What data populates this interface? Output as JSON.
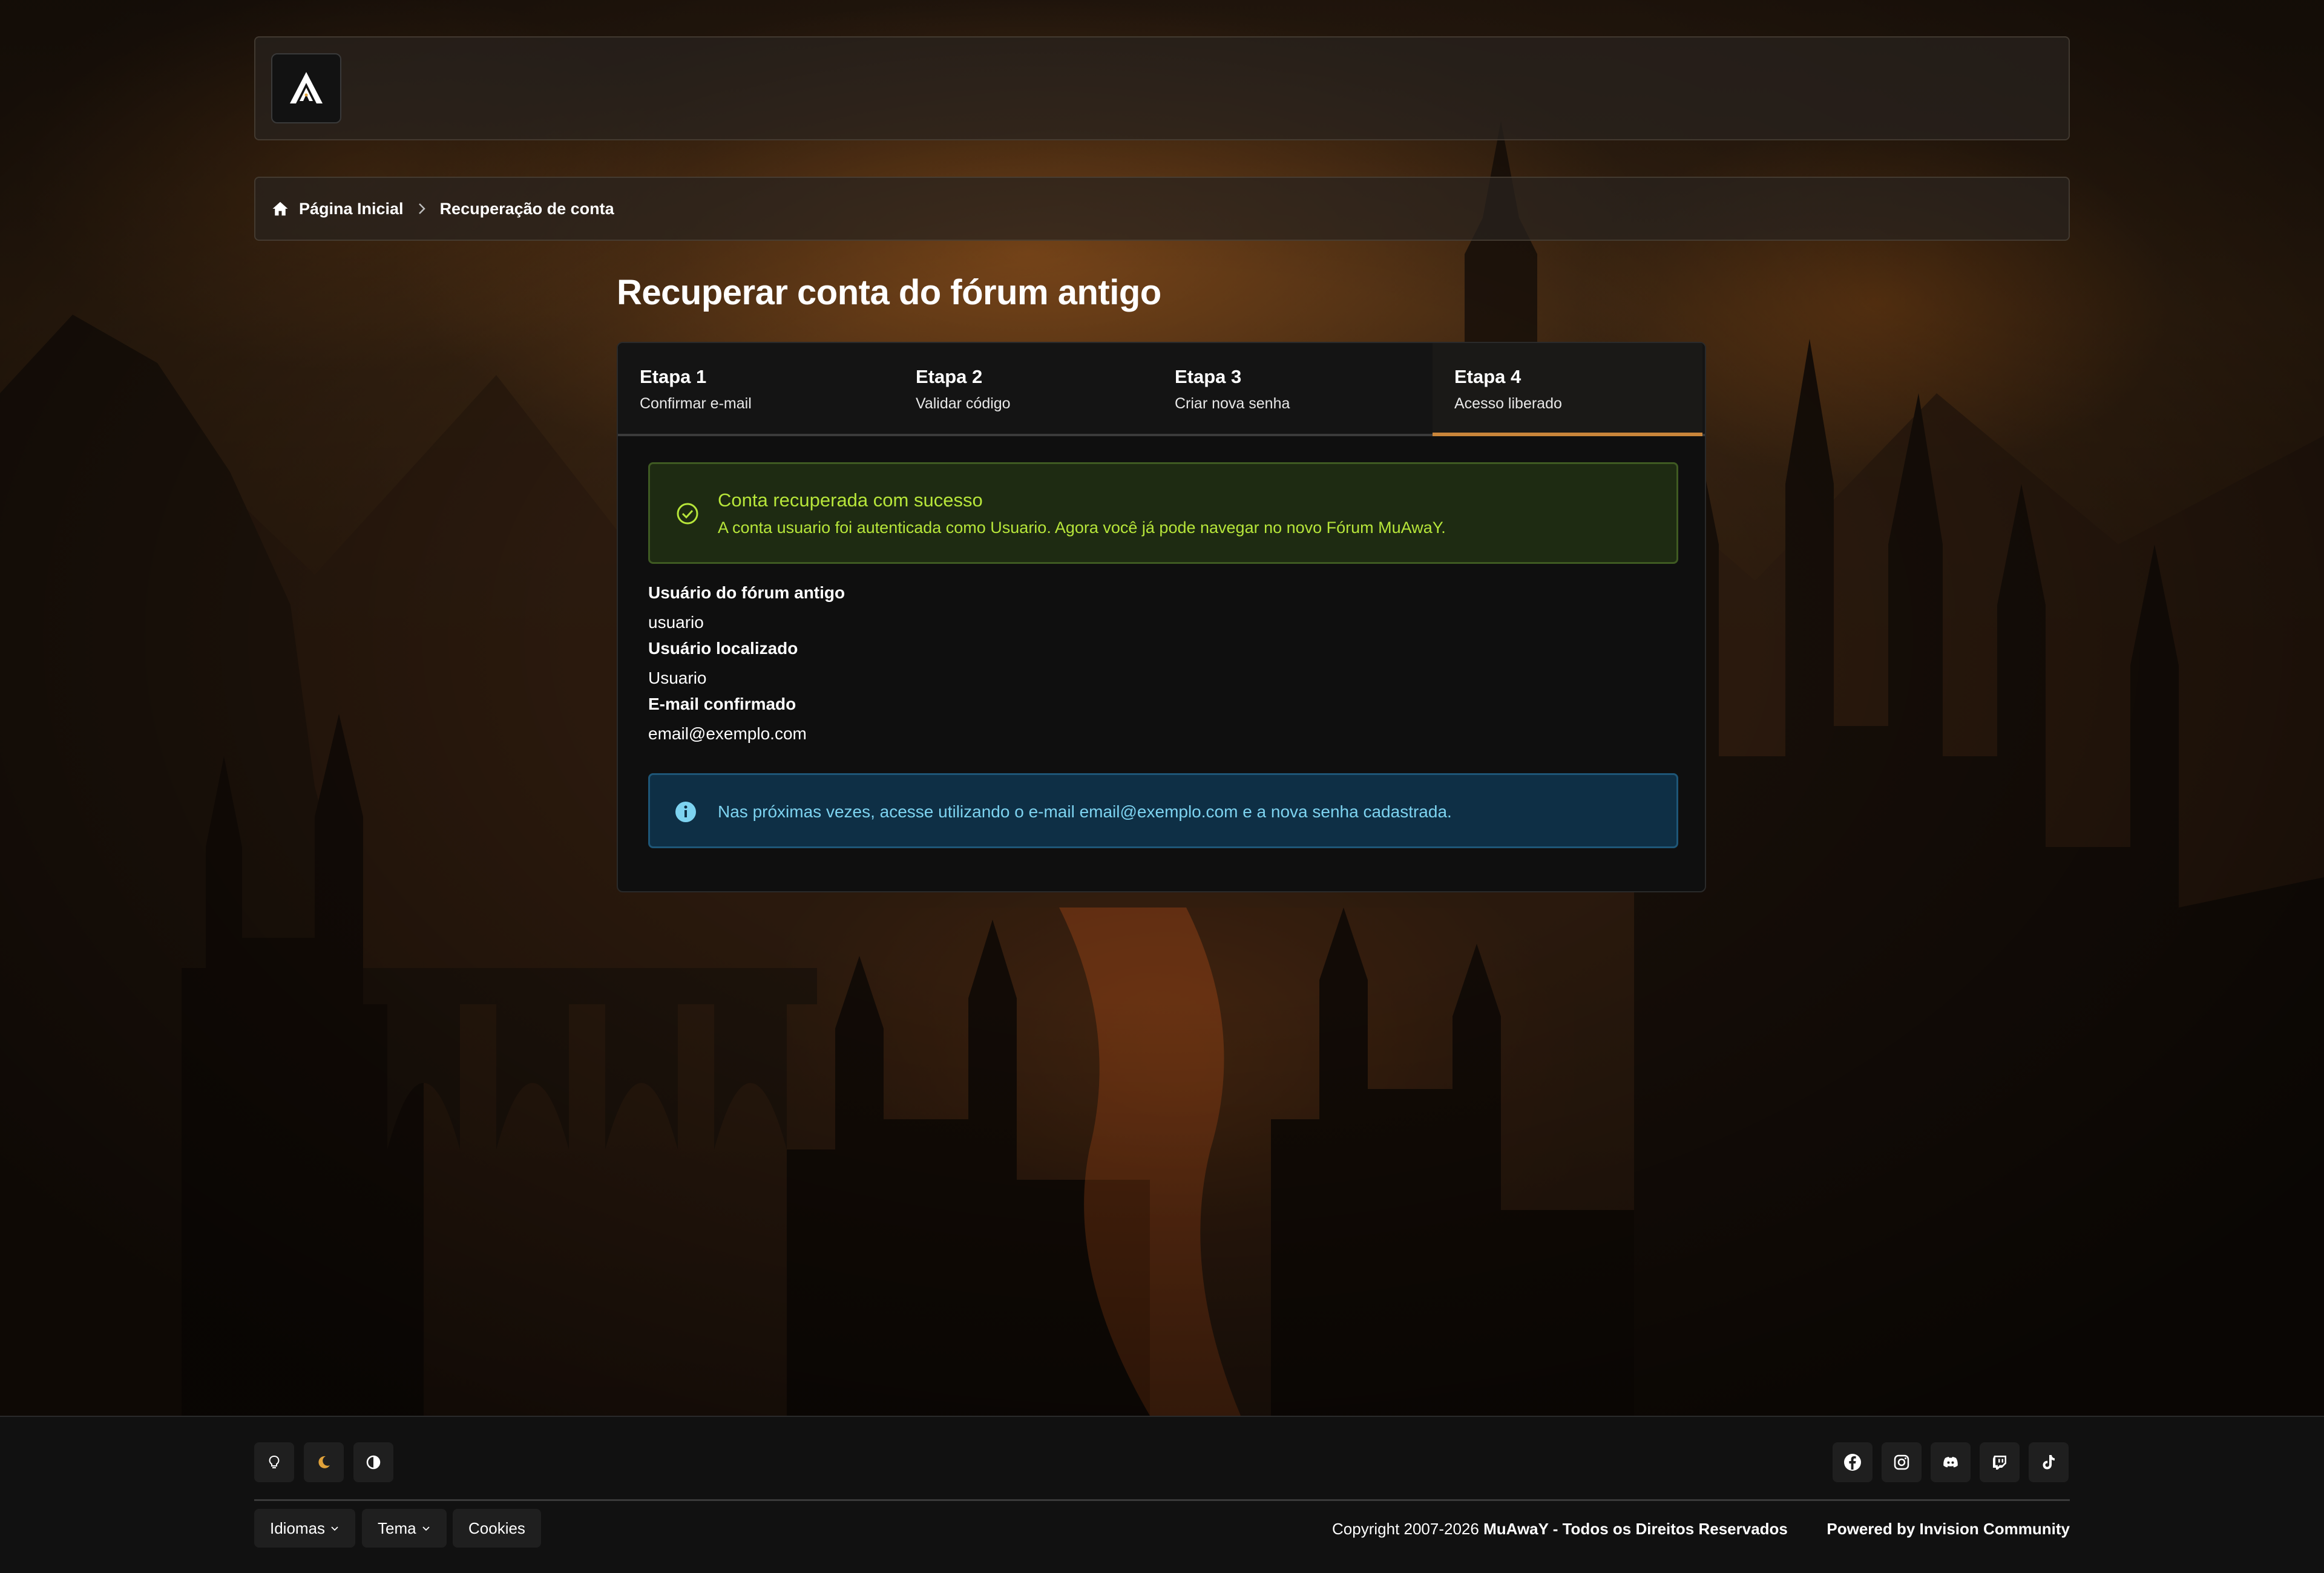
{
  "breadcrumb": {
    "home": "Página Inicial",
    "current": "Recuperação de conta"
  },
  "page": {
    "title": "Recuperar conta do fórum antigo"
  },
  "steps": [
    {
      "title": "Etapa 1",
      "desc": "Confirmar e-mail"
    },
    {
      "title": "Etapa 2",
      "desc": "Validar código"
    },
    {
      "title": "Etapa 3",
      "desc": "Criar nova senha"
    },
    {
      "title": "Etapa 4",
      "desc": "Acesso liberado"
    }
  ],
  "active_step": 4,
  "success_alert": {
    "title": "Conta recuperada com sucesso",
    "message": "A conta usuario foi autenticada como Usuario. Agora você já pode navegar no novo Fórum MuAwaY."
  },
  "fields": [
    {
      "label": "Usuário do fórum antigo",
      "value": "usuario"
    },
    {
      "label": "Usuário localizado",
      "value": "Usuario"
    },
    {
      "label": "E-mail confirmado",
      "value": "email@exemplo.com"
    }
  ],
  "info_alert": {
    "message": "Nas próximas vezes, acesse utilizando o e-mail email@exemplo.com e a nova senha cadastrada."
  },
  "footer": {
    "languages_label": "Idiomas",
    "theme_label": "Tema",
    "cookies_label": "Cookies",
    "copyright": "Copyright 2007-2026",
    "brand": "MuAwaY - Todos os Direitos Reservados",
    "powered": "Powered by Invision Community",
    "mode_icons": [
      "lightbulb-icon",
      "moon-icon",
      "contrast-icon"
    ],
    "social_icons": [
      "facebook-icon",
      "instagram-icon",
      "discord-icon",
      "twitch-icon",
      "tiktok-icon"
    ]
  },
  "colors": {
    "accent": "#c9853a",
    "success_text": "#b7e63a",
    "success_bg": "#1e2b12",
    "info_text": "#7dd3f0",
    "info_bg": "#0e2f45",
    "moon_active": "#e0a23a"
  }
}
